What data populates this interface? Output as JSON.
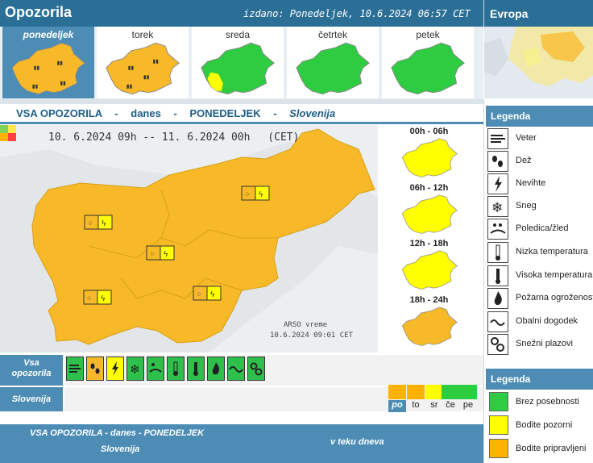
{
  "header": {
    "title": "Opozorila",
    "issued": "izdano: Ponedeljek, 10.6.2024 06:57 CET",
    "europe_label": "Evropa"
  },
  "days": [
    {
      "label": "ponedeljek",
      "level": "orange",
      "active": true
    },
    {
      "label": "torek",
      "level": "orange",
      "active": false
    },
    {
      "label": "sreda",
      "level": "green",
      "active": false
    },
    {
      "label": "četrtek",
      "level": "green",
      "active": false
    },
    {
      "label": "petek",
      "level": "green",
      "active": false
    }
  ],
  "section": {
    "t1": "VSA OPOZORILA",
    "t2": "danes",
    "t3": "PONEDELJEK",
    "t4": "Slovenija",
    "dash": "-"
  },
  "mainmap": {
    "range_from": "10. 6.2024 09h",
    "range_sep": "--",
    "range_to": "11. 6.2024 00h",
    "tz": "(CET)",
    "arso": "ARSO vreme",
    "arso_date": "10.6.2024 09:01 CET"
  },
  "slots": [
    {
      "label": "00h - 06h",
      "level": "yellow"
    },
    {
      "label": "06h - 12h",
      "level": "yellow"
    },
    {
      "label": "12h - 18h",
      "level": "yellow"
    },
    {
      "label": "18h - 24h",
      "level": "orange"
    }
  ],
  "legend_types": {
    "title": "Legenda",
    "items": [
      {
        "label": "Veter",
        "icon": "wind-icon"
      },
      {
        "label": "Dež",
        "icon": "rain-icon"
      },
      {
        "label": "Nevihte",
        "icon": "thunderstorm-icon"
      },
      {
        "label": "Sneg",
        "icon": "snow-icon"
      },
      {
        "label": "Poledica/žled",
        "icon": "ice-icon"
      },
      {
        "label": "Nizka temperatura",
        "icon": "low-temperature-icon"
      },
      {
        "label": "Visoka temperatura",
        "icon": "high-temperature-icon"
      },
      {
        "label": "Požarna ogroženost",
        "icon": "fire-danger-icon"
      },
      {
        "label": "Obalni dogodek",
        "icon": "coastal-icon"
      },
      {
        "label": "Snežni plazovi",
        "icon": "avalanche-icon"
      }
    ]
  },
  "legend_levels": {
    "title": "Legenda",
    "items": [
      {
        "label": "Brez posebnosti",
        "color": "#2ecc40"
      },
      {
        "label": "Bodite pozorni",
        "color": "#ffff00"
      },
      {
        "label": "Bodite pripravljeni",
        "color": "#ffb300"
      }
    ]
  },
  "bottom": {
    "vsa": "Vsa opozorila",
    "slovenija": "Slovenija",
    "days": [
      "po",
      "to",
      "sr",
      "če",
      "pe"
    ],
    "day_colors": [
      "#ffb300",
      "#ffb300",
      "#ffff00",
      "#2ecc40",
      "#2ecc40"
    ],
    "table_title": "VSA OPOZORILA - danes - PONEDELJEK",
    "table_sub": "Slovenija",
    "table_right": "v teku dneva"
  },
  "colors": {
    "orange": "#f7b928",
    "yellow": "#ffff00",
    "green": "#2ecc40",
    "accent": "#4d8db5"
  }
}
